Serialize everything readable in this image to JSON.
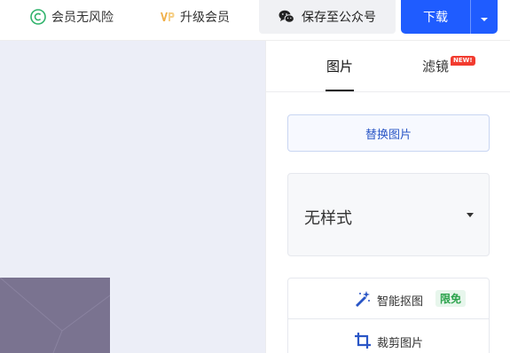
{
  "topbar": {
    "no_risk_label": "会员无风险",
    "no_risk_icon": "copyright-circle-icon",
    "upgrade_label": "升级会员",
    "upgrade_icon": "vip-crown-icon",
    "save_label": "保存至公众号",
    "save_icon": "wechat-icon",
    "download_label": "下载",
    "download_caret_icon": "caret-down-icon"
  },
  "panel": {
    "tabs": [
      {
        "label": "图片",
        "active": true
      },
      {
        "label": "滤镜",
        "badge": "NEW!"
      }
    ],
    "replace_button": "替换图片",
    "style_select": {
      "selected": "无样式",
      "icon": "caret-down-icon"
    },
    "tools": [
      {
        "label": "智能抠图",
        "icon": "magic-wand-icon",
        "badge": "限免"
      },
      {
        "label": "裁剪图片",
        "icon": "crop-icon"
      }
    ]
  },
  "colors": {
    "accent": "#1f5cff",
    "link_blue": "#2a56c6",
    "canvas_bg": "#eceef7",
    "new_badge": "#f23b2f",
    "free_badge_text": "#2aa24b",
    "free_badge_bg": "#e7f6ec"
  }
}
